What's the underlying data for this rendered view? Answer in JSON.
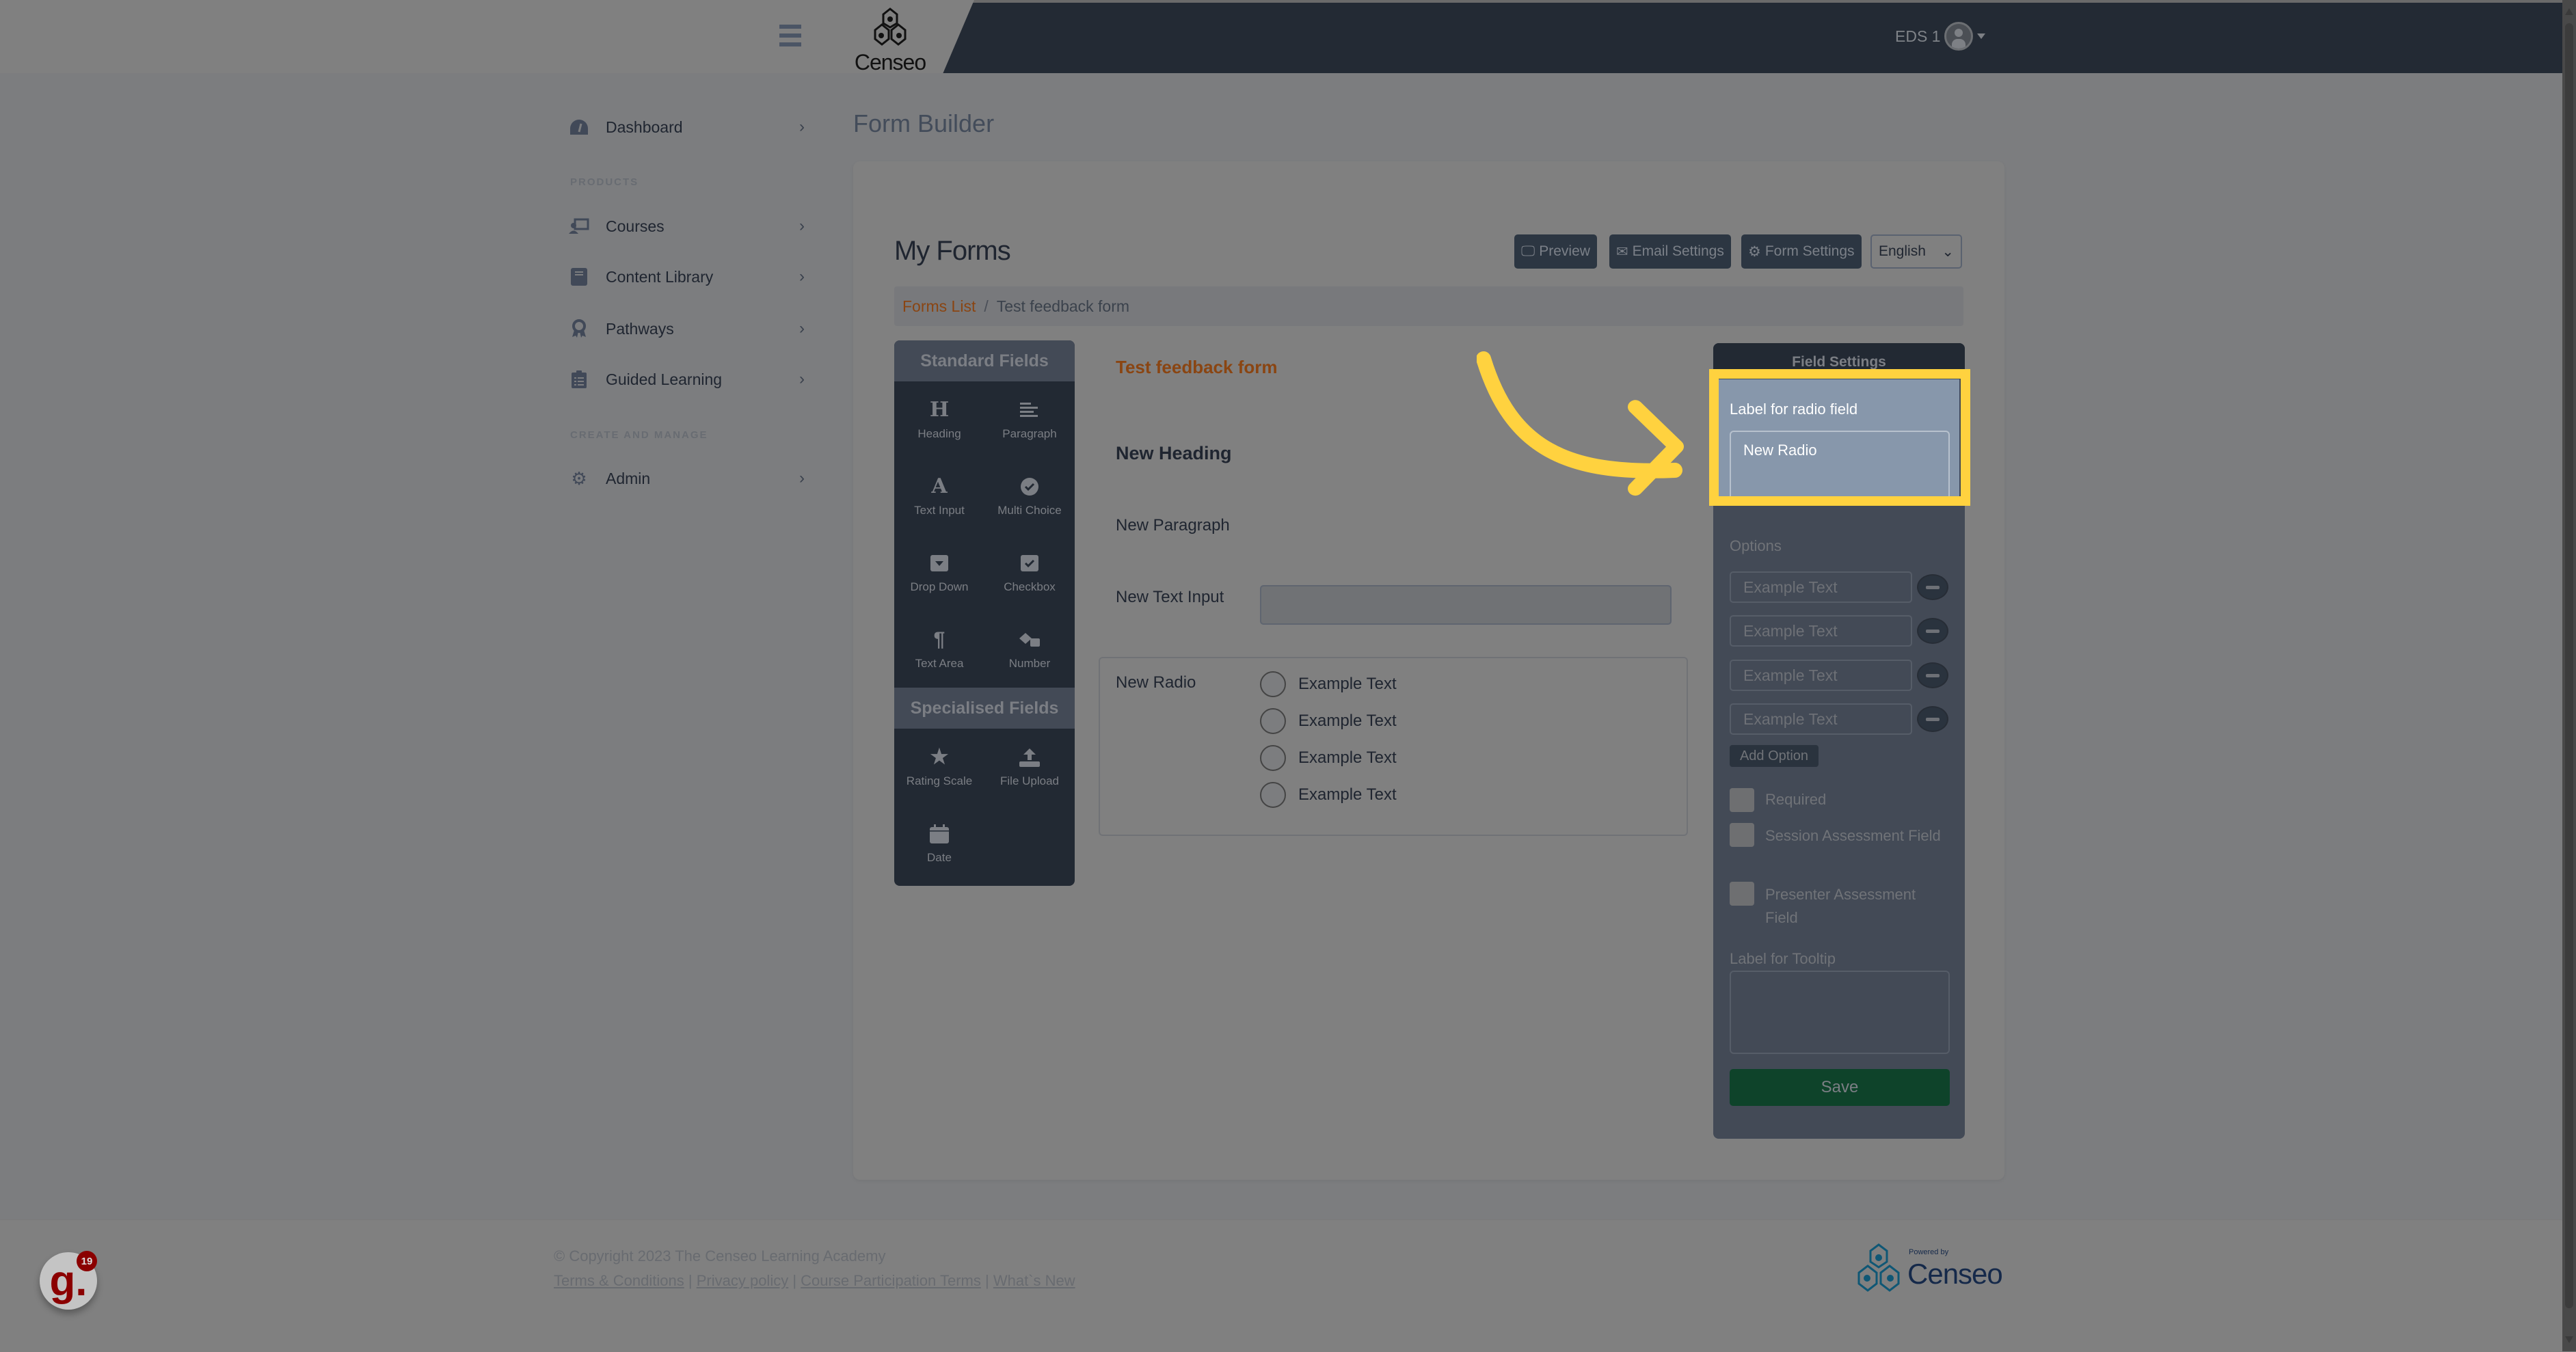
{
  "header": {
    "brand": "Censeo",
    "user_name": "EDS 1"
  },
  "sidebar": {
    "items": [
      {
        "label": "Dashboard",
        "icon": "dashboard-icon"
      },
      {
        "label": "Courses",
        "icon": "courses-icon"
      },
      {
        "label": "Content Library",
        "icon": "book-icon"
      },
      {
        "label": "Pathways",
        "icon": "award-icon"
      },
      {
        "label": "Guided Learning",
        "icon": "clipboard-list-icon"
      },
      {
        "label": "Admin",
        "icon": "gear-icon"
      }
    ],
    "sections": [
      "PRODUCTS",
      "CREATE AND MANAGE"
    ]
  },
  "page": {
    "title": "Form Builder",
    "heading": "My Forms",
    "toolbar": {
      "preview": "Preview",
      "email_settings": "Email Settings",
      "form_settings": "Form Settings",
      "language": "English"
    },
    "breadcrumb": {
      "root": "Forms List",
      "separator": "/",
      "current": "Test feedback form"
    }
  },
  "palette": {
    "standard_title": "Standard Fields",
    "standard": [
      {
        "label": "Heading",
        "icon": "heading-icon"
      },
      {
        "label": "Paragraph",
        "icon": "paragraph-align-icon"
      },
      {
        "label": "Text Input",
        "icon": "font-icon"
      },
      {
        "label": "Multi Choice",
        "icon": "check-circle-icon"
      },
      {
        "label": "Drop Down",
        "icon": "caret-square-icon"
      },
      {
        "label": "Checkbox",
        "icon": "check-square-icon"
      },
      {
        "label": "Text Area",
        "icon": "pilcrow-icon"
      },
      {
        "label": "Number",
        "icon": "dice-icon"
      }
    ],
    "specialised_title": "Specialised Fields",
    "specialised": [
      {
        "label": "Rating Scale",
        "icon": "star-icon"
      },
      {
        "label": "File Upload",
        "icon": "upload-icon"
      },
      {
        "label": "Date",
        "icon": "calendar-icon"
      }
    ]
  },
  "form": {
    "title": "Test feedback form",
    "heading": "New Heading",
    "paragraph": "New Paragraph",
    "text_input_label": "New Text Input",
    "text_input_value": "",
    "radio_label": "New Radio",
    "radio_options": [
      "Example Text",
      "Example Text",
      "Example Text",
      "Example Text"
    ]
  },
  "field_settings": {
    "title": "Field Settings",
    "label_caption": "Label for radio field",
    "label_value": "New Radio",
    "options_caption": "Options",
    "options": [
      "Example Text",
      "Example Text",
      "Example Text",
      "Example Text"
    ],
    "add_option": "Add Option",
    "checkboxes": [
      {
        "label": "Required",
        "checked": false
      },
      {
        "label": "Session Assessment Field",
        "checked": false
      },
      {
        "label": "Presenter Assessment Field",
        "checked": false
      }
    ],
    "tooltip_caption": "Label for Tooltip",
    "tooltip_value": "",
    "save": "Save"
  },
  "footer": {
    "copyright": "© Copyright 2023 The Censeo Learning Academy",
    "links": [
      "Terms & Conditions",
      "Privacy policy",
      "Course Participation Terms",
      "What`s New"
    ],
    "link_separator": "|",
    "powered_by": "Powered by",
    "powered_brand": "Censeo",
    "badge_letter": "g.",
    "badge_count": "19"
  },
  "colors": {
    "accent_orange": "#8a4512",
    "header_dark": "#232a34",
    "save_green": "#0e432a",
    "highlight_yellow": "#ffd23f",
    "highlight_field_bg": "#8797ab"
  }
}
